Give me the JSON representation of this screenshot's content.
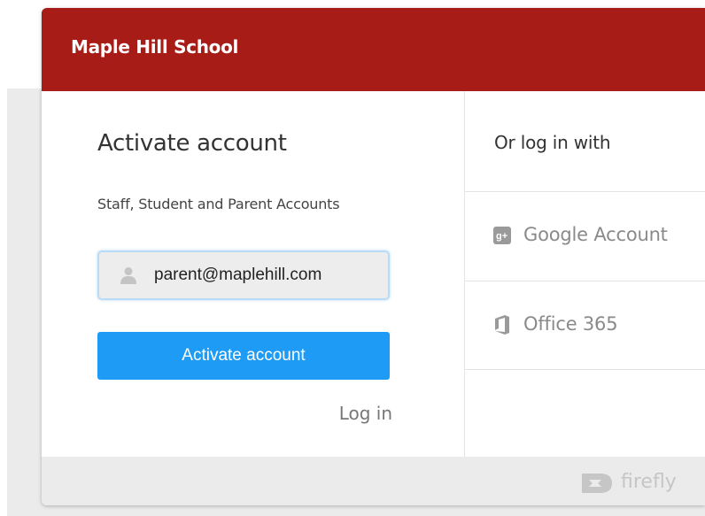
{
  "header": {
    "school_name": "Maple Hill School"
  },
  "activate": {
    "title": "Activate account",
    "subtitle": "Staff, Student and Parent Accounts",
    "email_value": "parent@maplehill.com",
    "user_icon": "user-icon",
    "button_label": "Activate account",
    "login_link": "Log in"
  },
  "alt_login": {
    "heading": "Or log in with",
    "providers": [
      {
        "label": "Google Account",
        "icon": "google-plus-icon"
      },
      {
        "label": "Office 365",
        "icon": "office-365-icon"
      }
    ]
  },
  "footer": {
    "brand": "firefly",
    "brand_icon": "firefly-logo-icon"
  },
  "colors": {
    "header_bg": "#a71c17",
    "button_bg": "#1e9bf5",
    "footer_bg": "#ebebeb"
  }
}
